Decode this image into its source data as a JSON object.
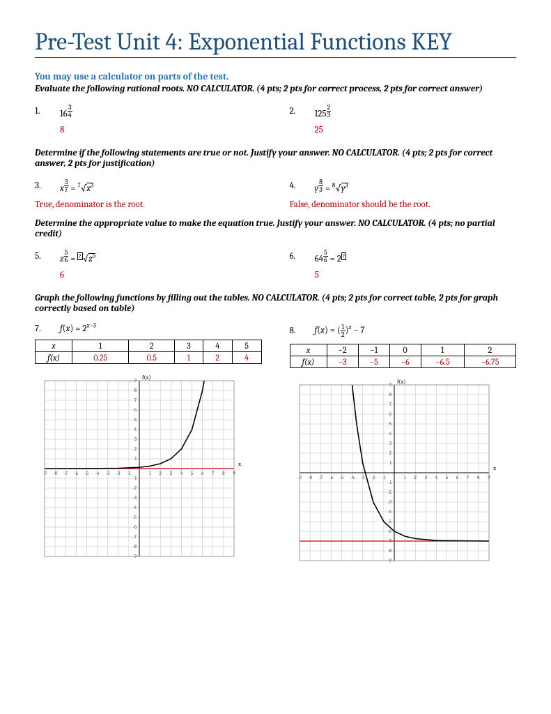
{
  "title": "Pre-Test Unit 4: Exponential Functions KEY",
  "subhead": "You may use a calculator on parts of the test.",
  "instr1": "Evaluate the following rational roots. NO CALCULATOR.  (4 pts; 2 pts for correct process, 2 pts for correct answer)",
  "q1": {
    "num": "1.",
    "expr": "16",
    "exp_n": "3",
    "exp_d": "4",
    "ans": "8"
  },
  "q2": {
    "num": "2.",
    "expr": "125",
    "exp_n": "2",
    "exp_d": "3",
    "ans": "25"
  },
  "instr2": "Determine if the following statements are true or not.  Justify your answer. NO CALCULATOR.  (4 pts; 2 pts for correct answer, 2 pts for justification)",
  "q3": {
    "num": "3.",
    "ans": "True, denominator is the root."
  },
  "q4": {
    "num": "4.",
    "ans": "False, denominator should be the root."
  },
  "instr3": "Determine the appropriate value to make the equation true. Justify your answer. NO CALCULATOR.  (4 pts; no partial credit)",
  "q5": {
    "num": "5.",
    "ans": "6"
  },
  "q6": {
    "num": "6.",
    "ans": "5"
  },
  "instr4": "Graph the following functions by filling out the tables. NO CALCULATOR.  (4 pts; 2 pts for correct table, 2 pts for graph correctly based on table)",
  "q7": {
    "num": "7.",
    "func_html": "f(x) = 2^{x-3}",
    "table": {
      "x_label": "x",
      "f_label": "f(x)",
      "x": [
        "1",
        "2",
        "3",
        "4",
        "5"
      ],
      "f": [
        "0.25",
        "0.5",
        "1",
        "2",
        "4"
      ]
    }
  },
  "q8": {
    "num": "8.",
    "func_html": "f(x) = (1/2)^x - 7",
    "table": {
      "x_label": "x",
      "f_label": "f(x)",
      "x": [
        "−2",
        "−1",
        "0",
        "1",
        "2"
      ],
      "f": [
        "−3",
        "−5",
        "−6",
        "−6.5",
        "−6.75"
      ]
    }
  },
  "chart_data": [
    {
      "type": "line",
      "title": "",
      "xlabel": "x",
      "ylabel": "f(x)",
      "xlim": [
        -9,
        9
      ],
      "ylim": [
        -9,
        9
      ],
      "series": [
        {
          "name": "f(x)=2^(x-3)",
          "points": [
            [
              -9,
              0.00024
            ],
            [
              -5,
              0.004
            ],
            [
              -2,
              0.031
            ],
            [
              0,
              0.125
            ],
            [
              1,
              0.25
            ],
            [
              2,
              0.5
            ],
            [
              3,
              1
            ],
            [
              4,
              2
            ],
            [
              5,
              4
            ],
            [
              6,
              8
            ],
            [
              6.17,
              9
            ]
          ]
        }
      ],
      "asymptote_y": 0
    },
    {
      "type": "line",
      "title": "",
      "xlabel": "x",
      "ylabel": "f(x)",
      "xlim": [
        -9,
        9
      ],
      "ylim": [
        -9,
        9
      ],
      "series": [
        {
          "name": "f(x)=(1/2)^x - 7",
          "points": [
            [
              -4,
              9
            ],
            [
              -3.58,
              5
            ],
            [
              -3,
              1
            ],
            [
              -2,
              -3
            ],
            [
              -1,
              -5
            ],
            [
              0,
              -6
            ],
            [
              1,
              -6.5
            ],
            [
              2,
              -6.75
            ],
            [
              4,
              -6.94
            ],
            [
              9,
              -7
            ]
          ]
        }
      ],
      "asymptote_y": -7
    }
  ]
}
